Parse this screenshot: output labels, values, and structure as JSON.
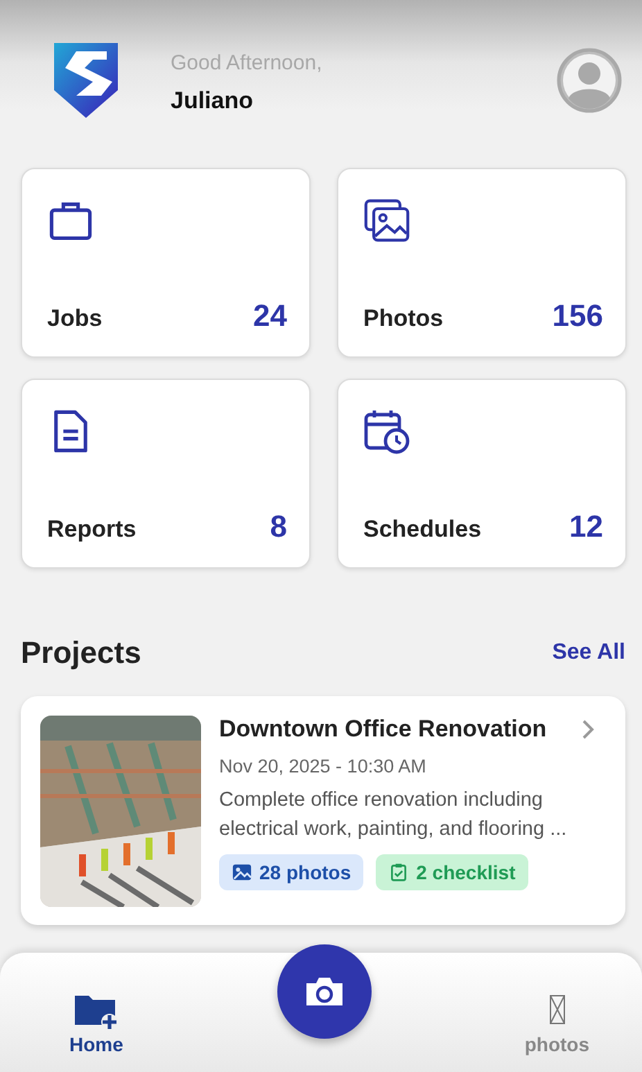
{
  "header": {
    "greeting": "Good Afternoon,",
    "user_name": "Juliano"
  },
  "stats": [
    {
      "kind": "jobs",
      "label": "Jobs",
      "count": "24"
    },
    {
      "kind": "photos",
      "label": "Photos",
      "count": "156"
    },
    {
      "kind": "reports",
      "label": "Reports",
      "count": "8"
    },
    {
      "kind": "schedules",
      "label": "Schedules",
      "count": "12"
    }
  ],
  "projects": {
    "title": "Projects",
    "see_all": "See All",
    "items": [
      {
        "title": "Downtown Office Renovation",
        "date": "Nov 20, 2025 - 10:30 AM",
        "description": "Complete office renovation including electrical work, painting, and flooring ...",
        "photos": "28 photos",
        "checklist": "2 checklist"
      }
    ]
  },
  "nav": [
    {
      "kind": "home",
      "label": "Home",
      "selected": true
    },
    {
      "kind": "camera"
    },
    {
      "kind": "photos",
      "label": "photos",
      "selected": false
    }
  ]
}
